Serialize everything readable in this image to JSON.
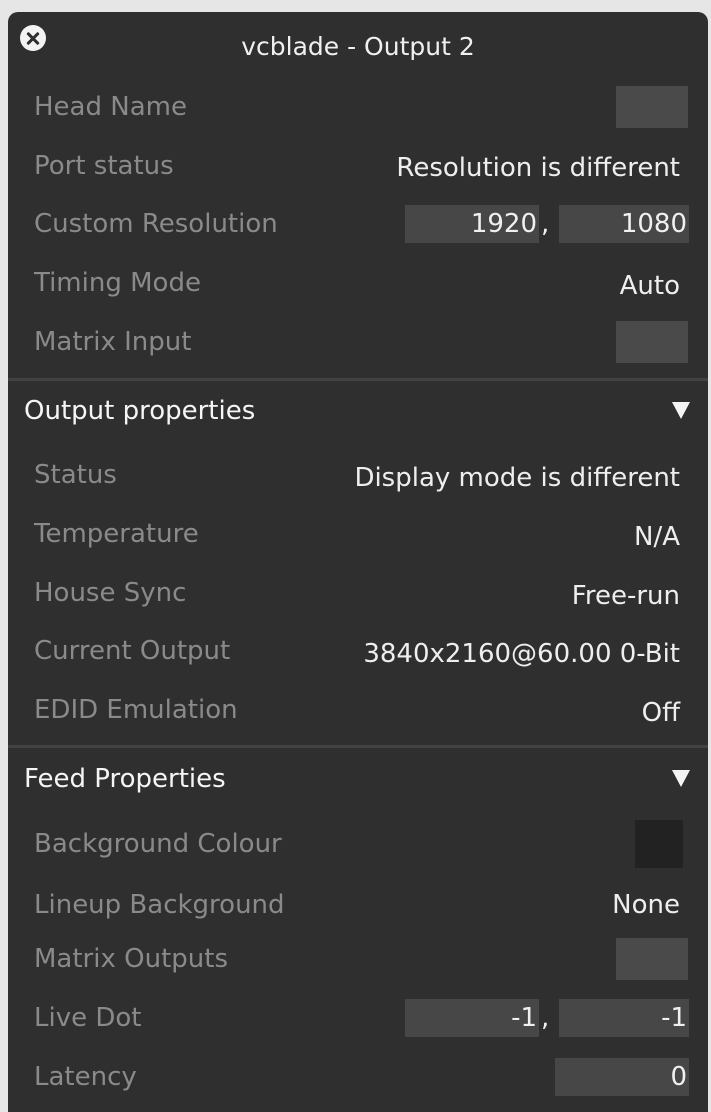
{
  "window": {
    "title": "vcblade - Output 2"
  },
  "top": {
    "head_name_label": "Head Name",
    "port_status_label": "Port status",
    "port_status_value": "Resolution is different",
    "custom_resolution_label": "Custom Resolution",
    "custom_resolution_width": "1920",
    "custom_resolution_height": "1080",
    "separator": ",",
    "timing_mode_label": "Timing Mode",
    "timing_mode_value": "Auto",
    "matrix_input_label": "Matrix Input"
  },
  "output_properties": {
    "title": "Output properties",
    "status_label": "Status",
    "status_value": "Display mode is different",
    "temperature_label": "Temperature",
    "temperature_value": "N/A",
    "house_sync_label": "House Sync",
    "house_sync_value": "Free-run",
    "current_output_label": "Current Output",
    "current_output_value": "3840x2160@60.00 0-Bit",
    "edid_label": "EDID Emulation",
    "edid_value": "Off"
  },
  "feed_properties": {
    "title": "Feed Properties",
    "background_colour_label": "Background Colour",
    "background_colour_value": "#222222",
    "lineup_background_label": "Lineup Background",
    "lineup_background_value": "None",
    "matrix_outputs_label": "Matrix Outputs",
    "live_dot_label": "Live Dot",
    "live_dot_x": "-1",
    "live_dot_y": "-1",
    "latency_label": "Latency",
    "latency_value": "0"
  },
  "colors": {
    "panel": "#2f2f2f",
    "field": "#474747",
    "label": "#8a8a8a",
    "text": "#eeeeee"
  },
  "icons": {
    "close": "close-icon",
    "collapse": "triangle-down-icon"
  }
}
